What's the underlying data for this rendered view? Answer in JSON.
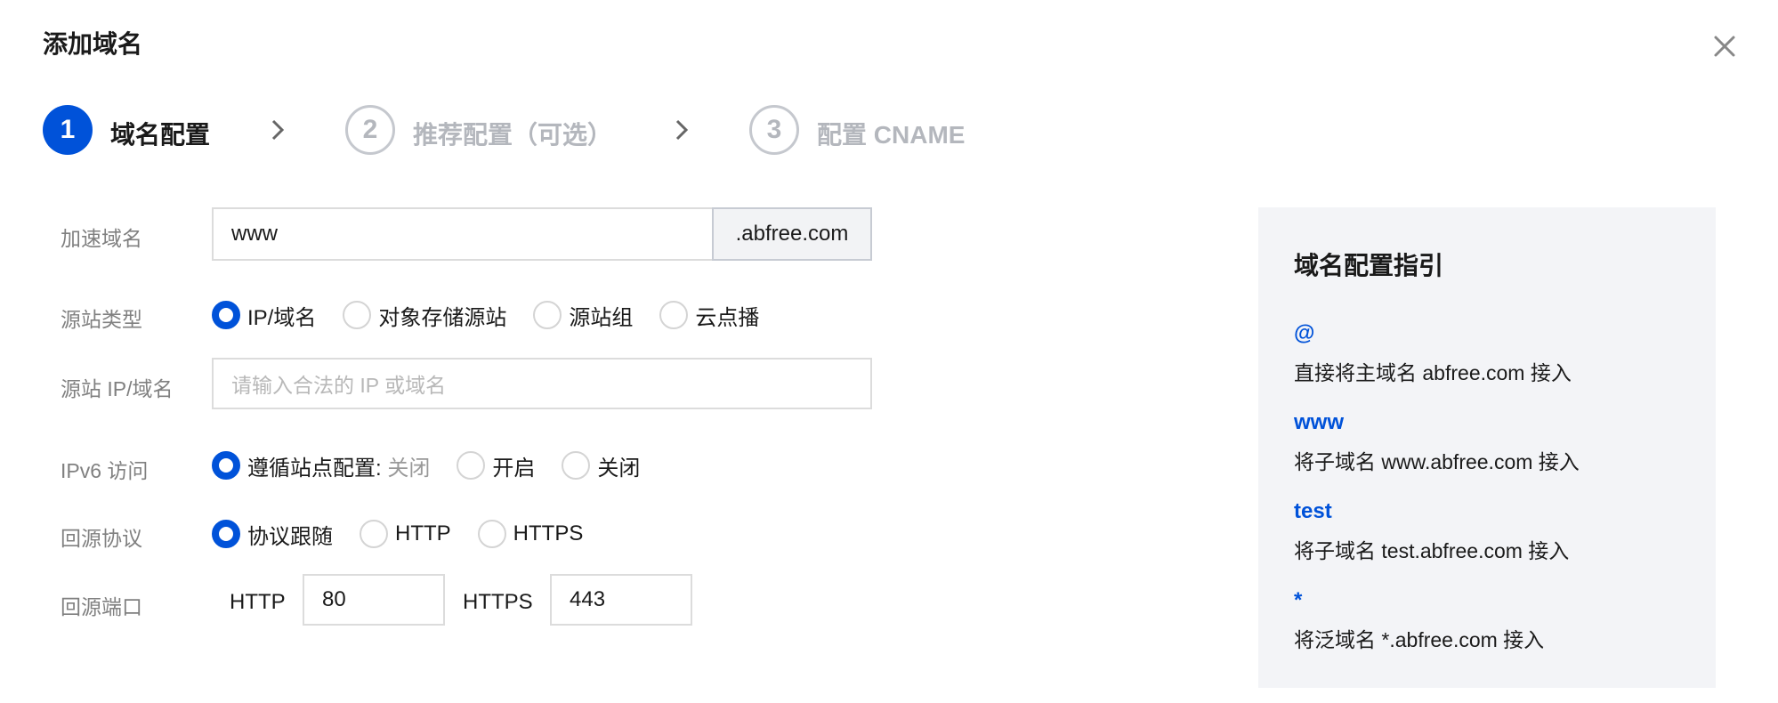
{
  "dialog": {
    "title": "添加域名"
  },
  "steps": [
    {
      "number": "1",
      "label": "域名配置"
    },
    {
      "number": "2",
      "label": "推荐配置（可选）"
    },
    {
      "number": "3",
      "label": "配置 CNAME"
    }
  ],
  "form": {
    "domain": {
      "label": "加速域名",
      "value": "www",
      "suffix": ".abfree.com"
    },
    "origin_type": {
      "label": "源站类型",
      "options": [
        "IP/域名",
        "对象存储源站",
        "源站组",
        "云点播"
      ],
      "selected": "IP/域名"
    },
    "origin_address": {
      "label": "源站 IP/域名",
      "placeholder": "请输入合法的 IP 或域名"
    },
    "ipv6": {
      "label": "IPv6 访问",
      "options": [
        "遵循站点配置:",
        "开启",
        "关闭"
      ],
      "inherit_state": " 关闭",
      "selected": "遵循站点配置:"
    },
    "protocol": {
      "label": "回源协议",
      "options": [
        "协议跟随",
        "HTTP",
        "HTTPS"
      ],
      "selected": "协议跟随"
    },
    "port": {
      "label": "回源端口",
      "http_label": "HTTP",
      "http_value": "80",
      "https_label": "HTTPS",
      "https_value": "443"
    }
  },
  "guide": {
    "title": "域名配置指引",
    "items": [
      {
        "key": "@",
        "desc": "直接将主域名 abfree.com 接入"
      },
      {
        "key": "www",
        "desc": "将子域名 www.abfree.com 接入"
      },
      {
        "key": "test",
        "desc": "将子域名 test.abfree.com 接入"
      },
      {
        "key": "*",
        "desc": "将泛域名 *.abfree.com 接入"
      }
    ]
  },
  "colors": {
    "primary": "#0052d9",
    "panel_bg": "#f3f4f7",
    "muted_text": "#808080"
  },
  "icons": {
    "close": "close-icon",
    "step_separator": "chevron-right-icon"
  }
}
